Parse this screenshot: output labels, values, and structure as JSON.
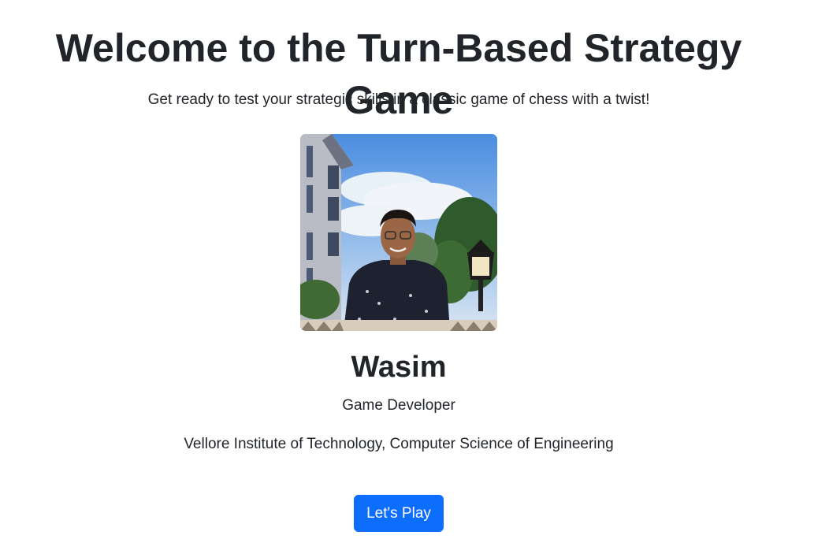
{
  "header": {
    "title": "Welcome to the Turn-Based Strategy Game",
    "subtitle": "Get ready to test your strategic skills in a classic game of chess with a twist!"
  },
  "profile": {
    "photo_icon": "profile-photo",
    "name": "Wasim",
    "role": "Game Developer",
    "organization": "Vellore Institute of Technology, Computer Science of Engineering"
  },
  "actions": {
    "play_label": "Let's Play"
  },
  "colors": {
    "primary_button": "#0d6efd",
    "text": "#212529"
  }
}
